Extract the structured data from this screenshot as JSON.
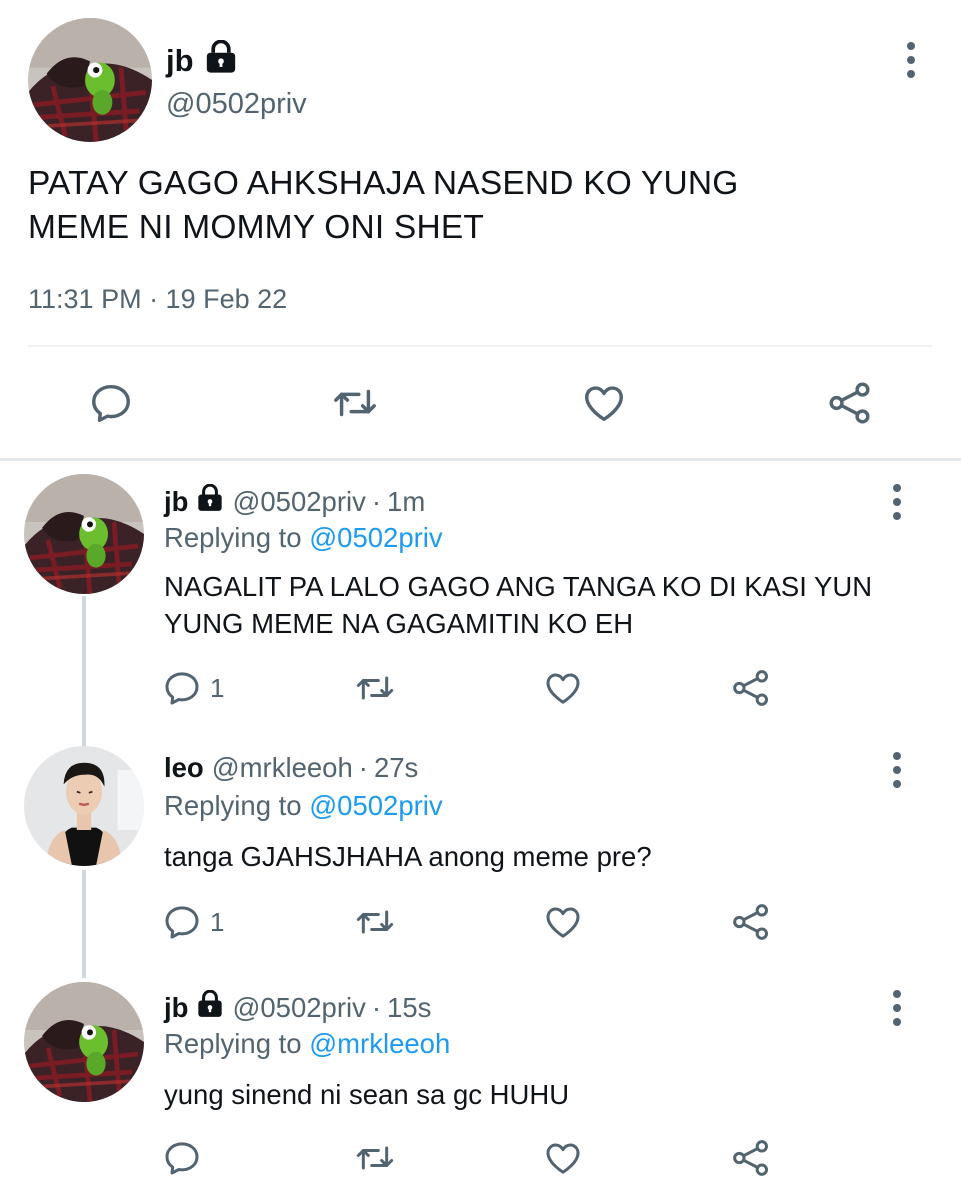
{
  "main_tweet": {
    "name": "jb",
    "handle": "@0502priv",
    "text_line1": "PATAY GAGO AHKSHAJA NASEND KO YUNG",
    "text_line2": "MEME NI MOMMY ONI SHET",
    "timestamp": "11:31 PM · 19 Feb 22"
  },
  "replies": [
    {
      "name": "jb",
      "locked": true,
      "handle": "@0502priv",
      "time": "1m",
      "replying_prefix": "Replying to",
      "replying_to": "@0502priv",
      "text_line1": "NAGALIT PA LALO GAGO ANG TANGA KO DI KASI YUN",
      "text_line2": "YUNG MEME NA GAGAMITIN KO EH",
      "reply_count": "1"
    },
    {
      "name": "leo",
      "locked": false,
      "handle": "@mrkleeoh",
      "time": "27s",
      "replying_prefix": "Replying to",
      "replying_to": "@0502priv",
      "text_line1": "tanga GJAHSJHAHA anong meme pre?",
      "text_line2": "",
      "reply_count": "1"
    },
    {
      "name": "jb",
      "locked": true,
      "handle": "@0502priv",
      "time": "15s",
      "replying_prefix": "Replying to",
      "replying_to": "@mrkleeoh",
      "text_line1": "yung sinend ni sean sa gc HUHU",
      "text_line2": "",
      "reply_count": ""
    }
  ],
  "separator": "·",
  "colors": {
    "text": "#0f1419",
    "secondary": "#536471",
    "link": "#1d9bf0",
    "divider": "#eff3f4"
  },
  "icons": [
    "lock-icon",
    "more-vertical-icon",
    "reply-icon",
    "retweet-icon",
    "like-icon",
    "share-icon"
  ]
}
